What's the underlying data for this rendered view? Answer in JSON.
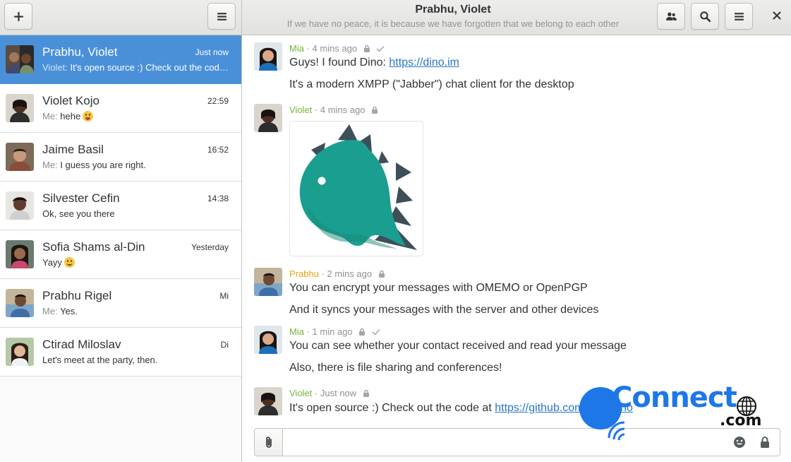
{
  "colors": {
    "accent": "#4a90d9",
    "mia": "#73b43a",
    "violet": "#73b43a",
    "prabhu": "#e5a50a",
    "link": "#2a76c6",
    "dino": "#1a9e8f",
    "dino_spikes": "#3d4f58"
  },
  "header": {
    "title": "Prabhu, Violet",
    "subtitle": "If we have no peace, it is because we have forgotten that we belong to each other",
    "icons": {
      "add": "plus-icon",
      "menu": "hamburger-icon",
      "participants": "people-icon",
      "search": "search-icon",
      "main_menu": "hamburger-icon",
      "close": "close-icon"
    }
  },
  "conversations": [
    {
      "name": "Prabhu, Violet",
      "time": "Just now",
      "sender": "Violet:",
      "preview": "It's open source :) Check out the code at https://github.com/dino/dino",
      "selected": true
    },
    {
      "name": "Violet Kojo",
      "time": "22:59",
      "sender": "Me:",
      "preview": "hehe",
      "emoji": "tongue"
    },
    {
      "name": "Jaime Basil",
      "time": "16:52",
      "sender": "Me:",
      "preview": "I guess you are right."
    },
    {
      "name": "Silvester Cefin",
      "time": "14:38",
      "sender": "",
      "preview": "Ok, see you there"
    },
    {
      "name": "Sofia Shams al-Din",
      "time": "Yesterday",
      "sender": "",
      "preview": "Yayy",
      "emoji": "smile"
    },
    {
      "name": "Prabhu Rigel",
      "time": "Mi",
      "sender": "Me:",
      "preview": "Yes."
    },
    {
      "name": "Ctirad Miloslav",
      "time": "Di",
      "sender": "",
      "preview": "Let's meet at the party, then."
    }
  ],
  "messages": [
    {
      "author": "Mia",
      "time": "· 4 mins ago",
      "encrypted": true,
      "read": true,
      "line1_text": "Guys! I found Dino: ",
      "line1_link": "https://dino.im",
      "line2": "It's a modern XMPP (\"Jabber\") chat client for the desktop"
    },
    {
      "author": "Violet",
      "time": "· 4 mins ago",
      "encrypted": true,
      "image": "dino-logo"
    },
    {
      "author": "Prabhu",
      "time": "· 2 mins ago",
      "encrypted": true,
      "line1": "You can encrypt your messages with OMEMO or OpenPGP",
      "line2": "And it syncs your messages with the server and other devices"
    },
    {
      "author": "Mia",
      "time": "· 1 min ago",
      "encrypted": true,
      "read": true,
      "line1": "You can see whether your contact received and read your message",
      "line2": "Also, there is file sharing and conferences!"
    },
    {
      "author": "Violet",
      "time": "· Just now",
      "encrypted": true,
      "line1_text": "It's open source :) Check out the code at ",
      "line1_link": "https://github.com/dino/dino"
    }
  ],
  "composer": {
    "placeholder": "",
    "value": "",
    "icons": {
      "attach": "paperclip-icon",
      "emoji": "emoji-icon",
      "encryption": "lock-icon"
    }
  },
  "watermark": {
    "text": "Connect",
    "suffix": ".com"
  }
}
